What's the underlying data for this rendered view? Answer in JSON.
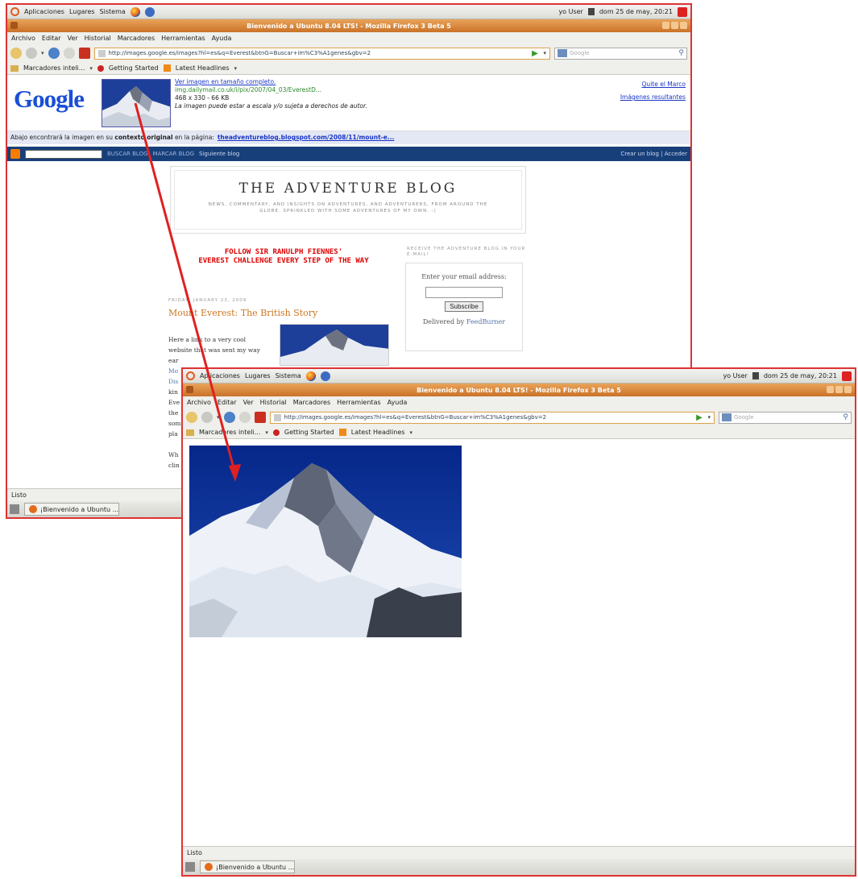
{
  "panel": {
    "menus": [
      "Aplicaciones",
      "Lugares",
      "Sistema"
    ],
    "user": "yo User",
    "clock": "dom 25 de may, 20:21"
  },
  "window": {
    "title": "Bienvenido a Ubuntu 8.04 LTS! - Mozilla Firefox 3 Beta 5",
    "menu": [
      "Archivo",
      "Editar",
      "Ver",
      "Historial",
      "Marcadores",
      "Herramientas",
      "Ayuda"
    ],
    "url": "http://images.google.es/images?hl=es&q=Everest&btnG=Buscar+im%C3%A1genes&gbv=2",
    "search_placeholder": "Google",
    "bookmarks": [
      "Marcadores inteli...",
      "Getting Started",
      "Latest Headlines"
    ],
    "status": "Listo",
    "task_label": "¡Bienvenido a Ubuntu ..."
  },
  "google": {
    "logo": "Google",
    "full_size_link": "Ver imagen en tamaño completo.",
    "source_url": "img.dailymail.co.uk/i/pix/2007/04_03/EverestD...",
    "dimensions": "468 x 330 - 66 KB",
    "copyright_note": "La imagen puede estar a escala y/o sujeta a derechos de autor.",
    "remove_frame": "Quite el Marco",
    "results_link": "Imágenes resultantes",
    "context_prefix": "Abajo encontrará la imagen en su ",
    "context_bold": "contexto original",
    "context_suffix": " en la página:",
    "context_link": "theadventureblog.blogspot.com/2008/11/mount-e..."
  },
  "blogger_bar": {
    "search_button": "BUSCAR BLOG",
    "flag_button": "MARCAR BLOG",
    "next_blog": "Siguiente blog",
    "right_links": "Crear un blog | Acceder"
  },
  "blog": {
    "title": "THE ADVENTURE BLOG",
    "description": "NEWS, COMMENTARY, AND INSIGHTS ON ADVENTURES, AND ADVENTURERS, FROM AROUND THE GLOBE. SPRINKLED WITH SOME ADVENTURES OF MY OWN. :)",
    "banner_line1": "FOLLOW SIR RANULPH FIENNES'",
    "banner_line2": "EVEREST CHALLENGE EVERY STEP OF THE WAY",
    "side_title": "RECEIVE THE ADVENTURE BLOG IN YOUR E-MAIL!",
    "email_label": "Enter your email address:",
    "subscribe_button": "Subscribe",
    "delivered_by": "Delivered by",
    "feedburner": "FeedBurner",
    "post_date": "FRIDAY, JANUARY 23, 2009",
    "post_title": "Mount Everest: The British Story",
    "post_lines": [
      "Here a link to a very cool",
      "website that was sent my way",
      "ear",
      "Mo",
      "Dis",
      "kin",
      "Eve",
      "the",
      "som",
      "pla",
      "",
      "Wh",
      "clin"
    ]
  },
  "colors": {
    "window_border": "#d33333",
    "titlebar": "#c97228",
    "blogger_bar": "#173f7a",
    "arrow": "#e02020",
    "banner_text": "#dd0000",
    "post_title": "#cc7722"
  }
}
